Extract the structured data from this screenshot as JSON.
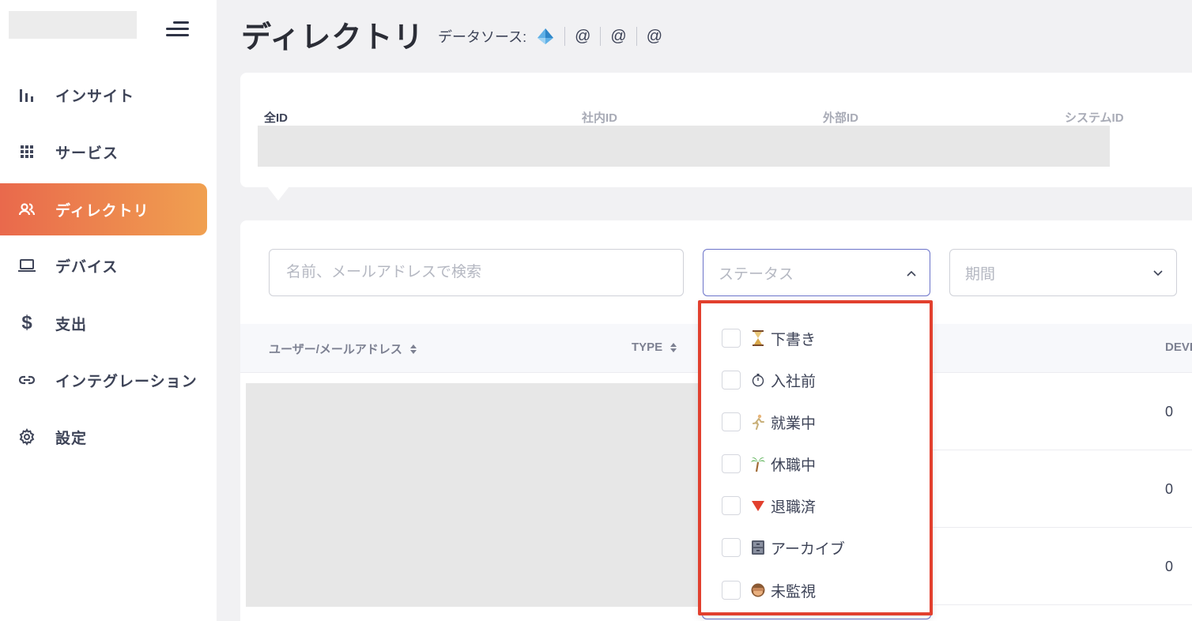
{
  "sidebar": {
    "items": [
      {
        "label": "インサイト",
        "icon": "bar-chart-icon"
      },
      {
        "label": "サービス",
        "icon": "grid-icon"
      },
      {
        "label": "ディレクトリ",
        "icon": "users-icon",
        "active": true
      },
      {
        "label": "デバイス",
        "icon": "laptop-icon"
      },
      {
        "label": "支出",
        "icon": "dollar-icon"
      },
      {
        "label": "インテグレーション",
        "icon": "link-icon"
      },
      {
        "label": "設定",
        "icon": "gear-icon"
      }
    ],
    "active_color_start": "#e9694c",
    "active_color_end": "#f0a050"
  },
  "header": {
    "title": "ディレクトリ",
    "datasource_label": "データソース:",
    "datasource_icons": [
      "diamond-icon",
      "@",
      "@",
      "@"
    ]
  },
  "id_tabs": [
    "全ID",
    "社内ID",
    "外部ID",
    "システムID"
  ],
  "filters": {
    "search_placeholder": "名前、メールアドレスで検索",
    "status_placeholder": "ステータス",
    "period_placeholder": "期間"
  },
  "table": {
    "columns": [
      "ユーザー/メールアドレス",
      "TYPE",
      "DEVI"
    ],
    "device_counts": [
      "0",
      "0",
      "0"
    ]
  },
  "status_dropdown": {
    "highlight_color": "#e2402e",
    "options": [
      {
        "emoji": "hourglass-icon",
        "label": "下書き"
      },
      {
        "emoji": "stopwatch-icon",
        "label": "入社前"
      },
      {
        "emoji": "running-person-icon",
        "label": "就業中"
      },
      {
        "emoji": "palm-tree-icon",
        "label": "休職中"
      },
      {
        "emoji": "red-triangle-icon",
        "label": "退職済"
      },
      {
        "emoji": "file-cabinet-icon",
        "label": "アーカイブ"
      },
      {
        "emoji": "see-no-evil-monkey-icon",
        "label": "未監視"
      }
    ]
  }
}
